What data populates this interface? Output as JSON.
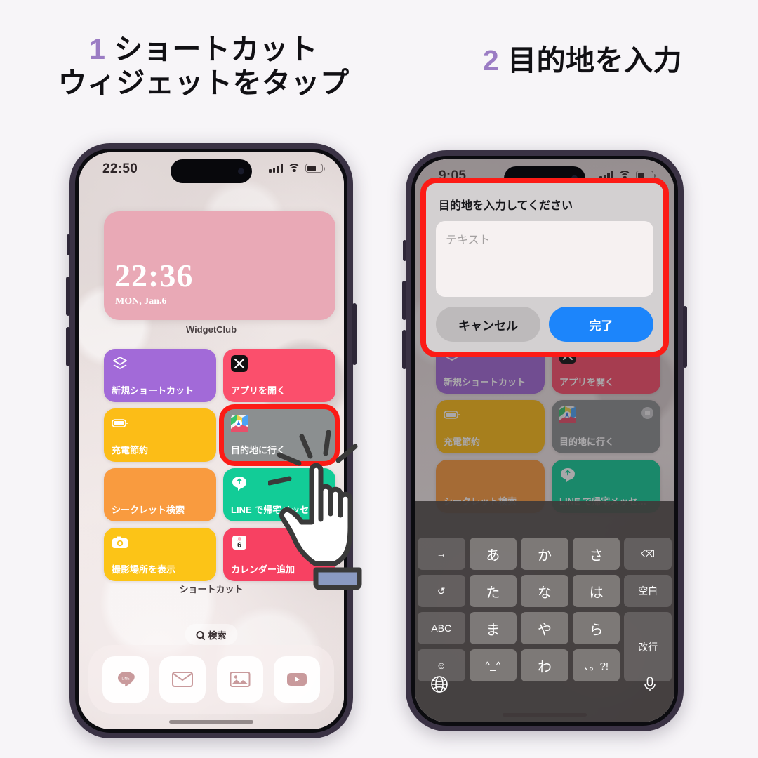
{
  "steps": [
    {
      "num": "1",
      "lines": [
        "ショートカット",
        "ウィジェットをタップ"
      ]
    },
    {
      "num": "2",
      "lines": [
        "目的地を入力"
      ]
    }
  ],
  "accent_purple": "#9b7cc4",
  "highlight_red": "#fc1b16",
  "phone1": {
    "status": {
      "time": "22:50"
    },
    "clock_widget": {
      "time": "22:36",
      "date": "MON, Jan.6",
      "caption": "WidgetClub"
    },
    "shortcuts_caption": "ショートカット",
    "shortcuts": [
      {
        "label": "新規ショートカット",
        "color": "#a26ad8",
        "icon": "layers-icon"
      },
      {
        "label": "アプリを開く",
        "color": "#fb4f6c",
        "icon": "x-app-icon"
      },
      {
        "label": "充電節約",
        "color": "#fcbd17",
        "icon": "battery-icon"
      },
      {
        "label": "目的地に行く",
        "color": "#8b8f90",
        "icon": "maps-icon"
      },
      {
        "label": "シークレット検索",
        "color": "#f99b3f",
        "icon": "none"
      },
      {
        "label": "LINE で帰宅メッセ…",
        "color": "#12cc97",
        "icon": "line-bubble-icon"
      },
      {
        "label": "撮影場所を表示",
        "color": "#fcc417",
        "icon": "camera-icon"
      },
      {
        "label": "カレンダー追加",
        "color": "#f74162",
        "icon": "calendar-6-icon"
      }
    ],
    "highlight_index": 3,
    "search": {
      "label": "検索"
    },
    "dock": [
      {
        "name": "line-app-icon"
      },
      {
        "name": "mail-app-icon"
      },
      {
        "name": "photos-app-icon"
      },
      {
        "name": "youtube-app-icon"
      }
    ]
  },
  "phone2": {
    "status": {
      "time": "9:05"
    },
    "dialog": {
      "title": "目的地を入力してください",
      "input_placeholder": "テキスト",
      "input_value": "",
      "cancel_label": "キャンセル",
      "done_label": "完了"
    },
    "shortcuts": [
      {
        "label": "新規ショートカット",
        "color": "#a26ad8"
      },
      {
        "label": "アプリを開く",
        "color": "#fb4f6c"
      },
      {
        "label": "充電節約",
        "color": "#fcbd17"
      },
      {
        "label": "目的地に行く",
        "color": "#8b8f90"
      },
      {
        "label": "シークレット検索",
        "color": "#f99b3f"
      },
      {
        "label": "LINE で帰宅メッセ…",
        "color": "#12cc97"
      }
    ],
    "keyboard": {
      "rows": [
        [
          "→",
          "あ",
          "か",
          "さ",
          "⌫"
        ],
        [
          "↺",
          "た",
          "な",
          "は",
          "空白"
        ],
        [
          "ABC",
          "ま",
          "や",
          "ら",
          "改行"
        ],
        [
          "☺",
          "^_^",
          "わ",
          "、。?!"
        ]
      ],
      "globe_icon": "globe-icon",
      "mic_icon": "microphone-icon"
    }
  }
}
